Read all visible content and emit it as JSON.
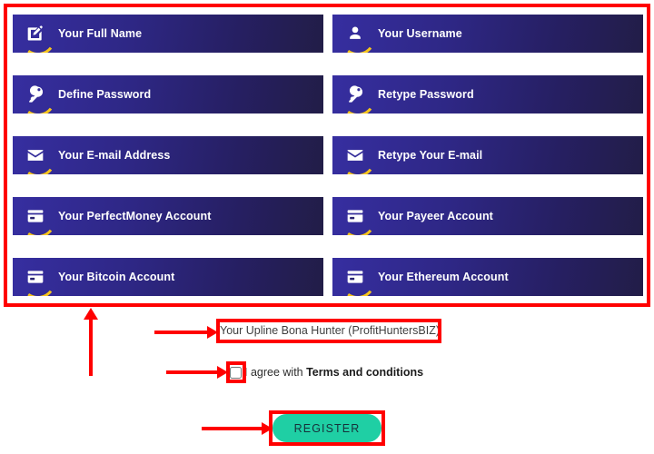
{
  "form": {
    "fields": [
      {
        "label": "Your Full Name",
        "icon": "edit-pencil-icon"
      },
      {
        "label": "Your Username",
        "icon": "user-icon"
      },
      {
        "label": "Define Password",
        "icon": "key-icon"
      },
      {
        "label": "Retype Password",
        "icon": "key-icon"
      },
      {
        "label": "Your E-mail Address",
        "icon": "envelope-icon"
      },
      {
        "label": "Retype Your E-mail",
        "icon": "envelope-icon"
      },
      {
        "label": "Your PerfectMoney Account",
        "icon": "credit-card-icon"
      },
      {
        "label": "Your Payeer Account",
        "icon": "credit-card-icon"
      },
      {
        "label": "Your Bitcoin Account",
        "icon": "credit-card-icon"
      },
      {
        "label": "Your Ethereum Account",
        "icon": "credit-card-icon"
      }
    ],
    "upline": {
      "value": "Your Upline Bona Hunter (ProfitHuntersBIZ)"
    },
    "terms": {
      "prefix": "I agree with ",
      "link_label": "Terms and conditions",
      "checked": false
    },
    "submit_label": "REGISTER"
  },
  "annotations": {
    "highlight_color": "#ff0000",
    "boxes": [
      {
        "name": "fields-anno-box"
      },
      {
        "name": "upline-anno-box"
      },
      {
        "name": "checkbox-anno-box"
      },
      {
        "name": "register-anno-box"
      }
    ]
  },
  "colors": {
    "field_gradient_start": "#362ea0",
    "field_gradient_end": "#221d47",
    "icon_swoosh": "#f6c51c",
    "submit_background": "#1fcfa4",
    "submit_text": "#16313a",
    "annotation": "#ff0000",
    "page_background": "#ffffff"
  }
}
